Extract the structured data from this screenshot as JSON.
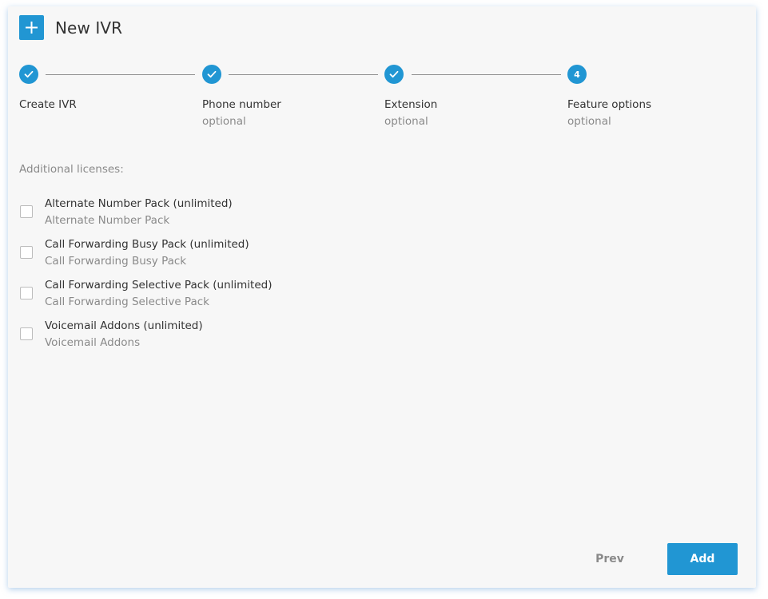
{
  "header": {
    "title": "New IVR",
    "icon": "plus-icon"
  },
  "colors": {
    "accent": "#2196d3",
    "text": "#333333",
    "muted": "#8a8a8a",
    "background": "#f7f7f7"
  },
  "steps": [
    {
      "label": "Create IVR",
      "sub": "",
      "state": "done",
      "icon": "check-icon"
    },
    {
      "label": "Phone number",
      "sub": "optional",
      "state": "done",
      "icon": "check-icon"
    },
    {
      "label": "Extension",
      "sub": "optional",
      "state": "done",
      "icon": "check-icon"
    },
    {
      "label": "Feature options",
      "sub": "optional",
      "state": "active",
      "number": "4"
    }
  ],
  "licenses": {
    "label": "Additional licenses:",
    "items": [
      {
        "name": "Alternate Number Pack (unlimited)",
        "desc": "Alternate Number Pack",
        "checked": false
      },
      {
        "name": "Call Forwarding Busy Pack (unlimited)",
        "desc": "Call Forwarding Busy Pack",
        "checked": false
      },
      {
        "name": "Call Forwarding Selective Pack (unlimited)",
        "desc": "Call Forwarding Selective Pack",
        "checked": false
      },
      {
        "name": "Voicemail Addons (unlimited)",
        "desc": "Voicemail Addons",
        "checked": false
      }
    ]
  },
  "footer": {
    "prev_label": "Prev",
    "add_label": "Add"
  }
}
